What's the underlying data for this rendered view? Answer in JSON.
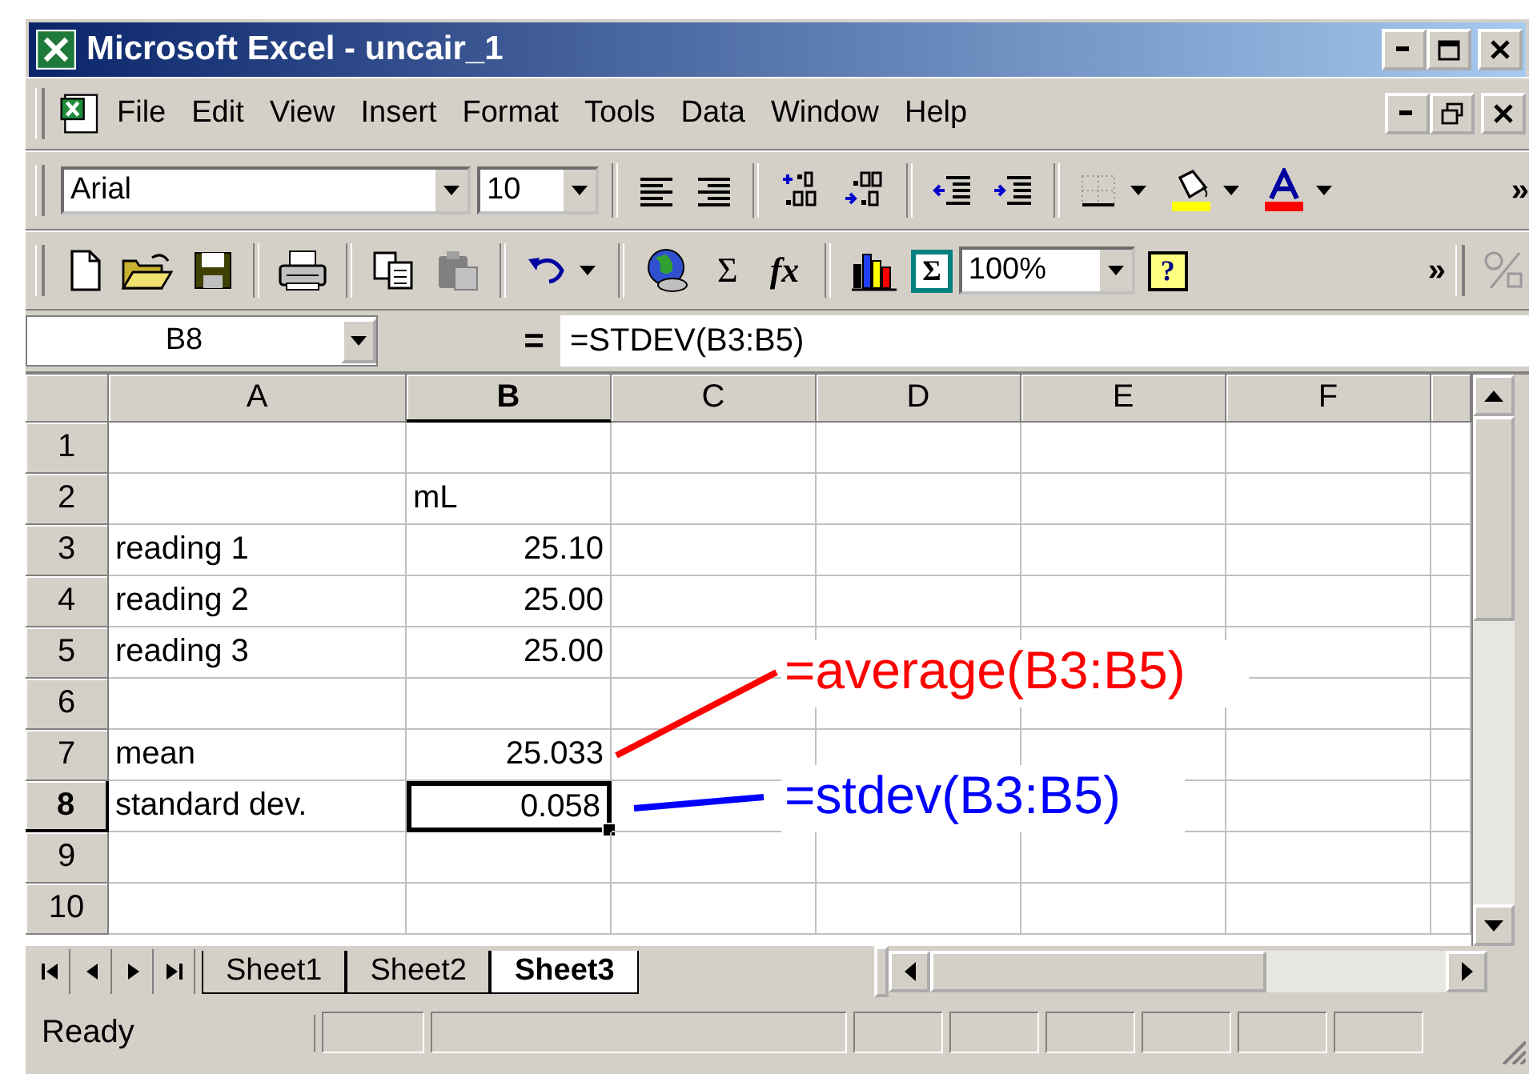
{
  "window": {
    "title": "Microsoft Excel - uncair_1"
  },
  "menu": [
    "File",
    "Edit",
    "View",
    "Insert",
    "Format",
    "Tools",
    "Data",
    "Window",
    "Help"
  ],
  "format_toolbar": {
    "font": "Arial",
    "size": "10",
    "overflow": "»"
  },
  "standard_toolbar": {
    "autosum": "Σ",
    "function": "fx",
    "stat_tool": "Σ",
    "zoom": "100%",
    "help": "?",
    "overflow": "»"
  },
  "formula_bar": {
    "name_box": "B8",
    "equals": "=",
    "formula": "=STDEV(B3:B5)"
  },
  "columns": [
    {
      "label": "A",
      "selected": false
    },
    {
      "label": "B",
      "selected": true
    },
    {
      "label": "C",
      "selected": false
    },
    {
      "label": "D",
      "selected": false
    },
    {
      "label": "E",
      "selected": false
    },
    {
      "label": "F",
      "selected": false
    }
  ],
  "rows": [
    {
      "header": "1",
      "selected": false
    },
    {
      "header": "2",
      "selected": false,
      "value": "mL"
    },
    {
      "header": "3",
      "selected": false,
      "label": "reading 1",
      "value": "25.10"
    },
    {
      "header": "4",
      "selected": false,
      "label": "reading 2",
      "value": "25.00"
    },
    {
      "header": "5",
      "selected": false,
      "label": "reading 3",
      "value": "25.00"
    },
    {
      "header": "6",
      "selected": false
    },
    {
      "header": "7",
      "selected": false,
      "label": "mean",
      "value": "25.033"
    },
    {
      "header": "8",
      "selected": true,
      "label": "standard dev.",
      "value": "0.058"
    },
    {
      "header": "9",
      "selected": false
    },
    {
      "header": "10",
      "selected": false
    }
  ],
  "annotations": [
    {
      "text": "=average(B3:B5)",
      "color": "#ff0000"
    },
    {
      "text": "=stdev(B3:B5)",
      "color": "#0000ff"
    }
  ],
  "sheet_tabs": [
    {
      "label": "Sheet1",
      "selected": false
    },
    {
      "label": "Sheet2",
      "selected": false
    },
    {
      "label": "Sheet3",
      "selected": true
    }
  ],
  "status_bar": {
    "text": "Ready"
  }
}
